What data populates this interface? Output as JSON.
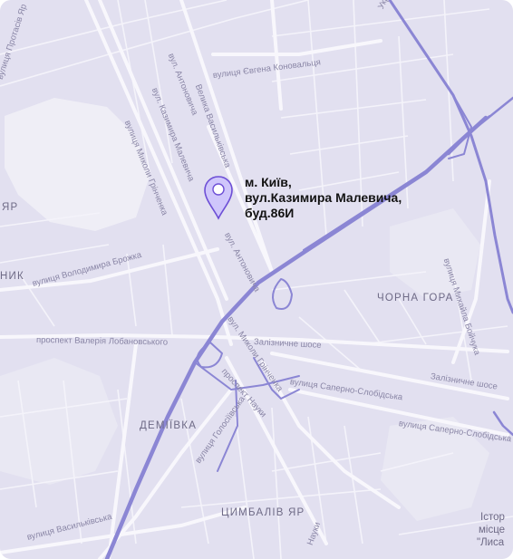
{
  "address": {
    "line1": "м. Київ,",
    "line2": "вул.Казимира Малевича,",
    "line3": "буд.86И"
  },
  "districts": {
    "chorna_hora": "ЧОРНА ГОРА",
    "demiivka": "ДЕМІЇВКА",
    "tsymbaliv_yar": "ЦИМБАЛІВ ЯР",
    "yar": "ЯР",
    "nyk": "НИК"
  },
  "streets": {
    "protasiv_yar": "вулиця Протасів Яр",
    "yevhena_konovaltsia": "вулиця Євгена Коновальця",
    "antonovycha_top": "вул. Антоновича",
    "kazymyra_malevycha": "вул. Казимира Малевича",
    "velyka_vasylkivska": "Велика Васильківська",
    "mykoly_hrinchenka": "вулиця Миколи Грінченка",
    "antonovycha_mid": "вул. Антоновича",
    "volodymyra_brozhka": "вулиця Володимира Брожка",
    "valeriia_lobanovskoho": "проспект Валерія Лобановського",
    "mykoly_hrinchenka_2": "вул. Миколи Грінченка",
    "zaliznychne_shose": "Залізничне шосе",
    "zaliznychne_shose_2": "Залізничне шосе",
    "prospekt_nauky": "проспект Науки",
    "saperno_slobidska": "вулиця Саперно-Слобідська",
    "saperno_slobidska_2": "вулиця Саперно-Слобідська",
    "holosiivska": "вулиця Голосіївська",
    "vasylkivska": "вулиця Васильківська",
    "mykhaila_boichuka": "вулиця Михайла Бойчука",
    "ukrainky": "Українки",
    "nauky_small": "Науки",
    "istor": "Істор",
    "mistse": "місце",
    "lysa": "\"Лиса"
  },
  "colors": {
    "land": "#e2e0f0",
    "road": "#f6f5fb",
    "highway": "#8b86d4",
    "park": "#efeef6",
    "pin": "#cfc6fb"
  },
  "icons": {
    "pin": "map-pin-icon"
  }
}
